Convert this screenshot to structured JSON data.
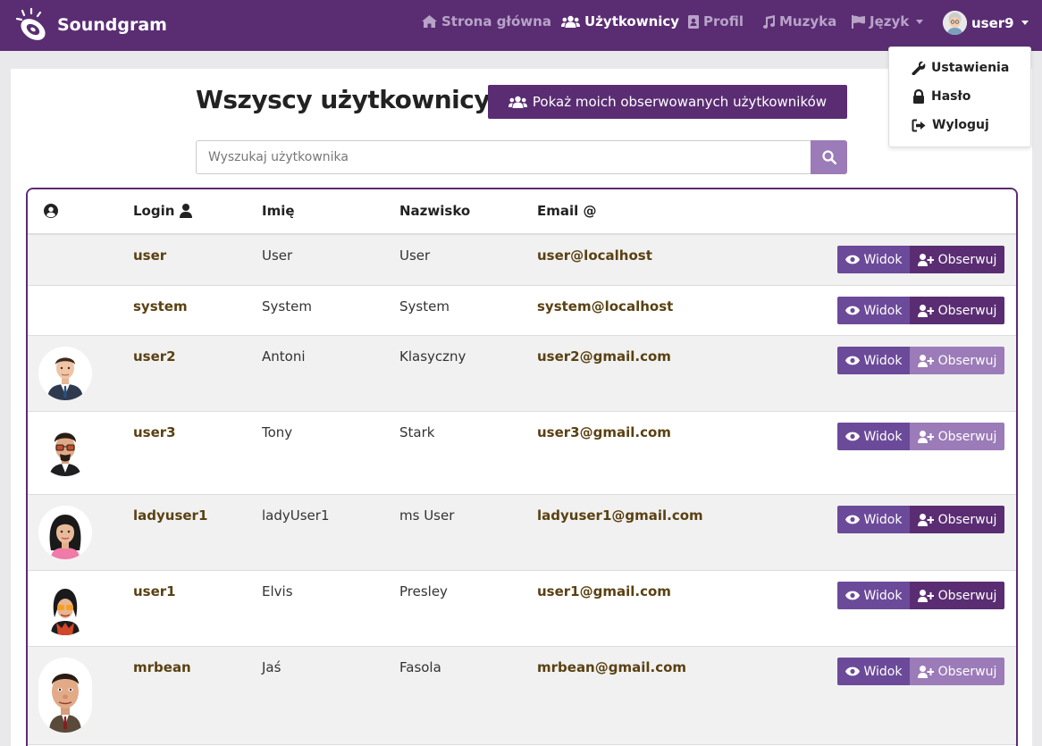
{
  "navbar": {
    "brand": "Soundgram",
    "home": "Strona główna",
    "users": "Użytkownicy",
    "profile": "Profil",
    "music": "Muzyka",
    "language": "Język",
    "username": "user9"
  },
  "dropdown": {
    "settings": "Ustawienia",
    "password": "Hasło",
    "logout": "Wyloguj"
  },
  "main": {
    "title": "Wszyscy użytkownicy",
    "follow_button": "Pokaż moich obserwowanych użytkowników",
    "search_placeholder": "Wyszukaj użytkownika"
  },
  "table": {
    "headers": {
      "login": "Login",
      "first_name": "Imię",
      "last_name": "Nazwisko",
      "email": "Email @"
    },
    "view_label": "Widok",
    "follow_label": "Obserwuj",
    "rows": [
      {
        "login": "user",
        "first_name": "User",
        "last_name": "User",
        "email": "user@localhost",
        "avatar": "none",
        "follow_enabled": true
      },
      {
        "login": "system",
        "first_name": "System",
        "last_name": "System",
        "email": "system@localhost",
        "avatar": "none",
        "follow_enabled": true
      },
      {
        "login": "user2",
        "first_name": "Antoni",
        "last_name": "Klasyczny",
        "email": "user2@gmail.com",
        "avatar": "man-suit",
        "follow_enabled": false
      },
      {
        "login": "user3",
        "first_name": "Tony",
        "last_name": "Stark",
        "email": "user3@gmail.com",
        "avatar": "man-glasses",
        "follow_enabled": false
      },
      {
        "login": "ladyuser1",
        "first_name": "ladyUser1",
        "last_name": "ms User",
        "email": "ladyuser1@gmail.com",
        "avatar": "woman",
        "follow_enabled": true
      },
      {
        "login": "user1",
        "first_name": "Elvis",
        "last_name": "Presley",
        "email": "user1@gmail.com",
        "avatar": "elvis",
        "follow_enabled": true
      },
      {
        "login": "mrbean",
        "first_name": "Jaś",
        "last_name": "Fasola",
        "email": "mrbean@gmail.com",
        "avatar": "mrbean",
        "follow_enabled": false
      }
    ]
  },
  "colors": {
    "brand": "#5a2d73",
    "view": "#6c4a9a",
    "follow_disabled": "#9b7bb8",
    "link": "#5a4112"
  }
}
